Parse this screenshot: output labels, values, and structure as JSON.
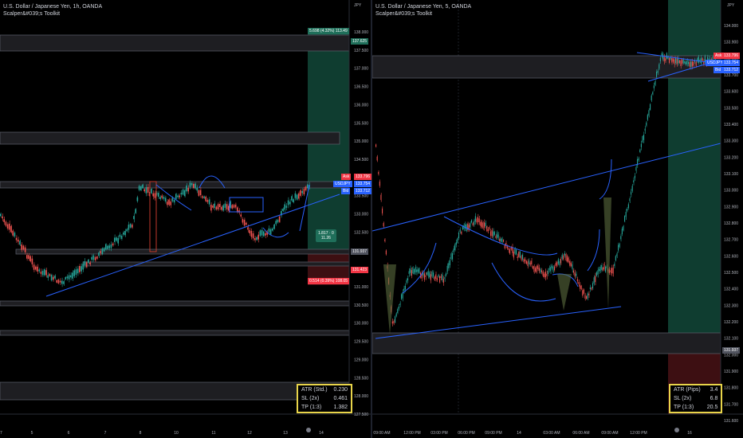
{
  "left_chart": {
    "title": "U.S. Dollar / Japanese Yen, 1h, OANDA",
    "subtitle": "Scalper&#039;s Toolkit",
    "currency": "JPY",
    "price_ticks": [
      "138.000",
      "137.500",
      "137.000",
      "136.500",
      "136.000",
      "135.500",
      "135.000",
      "134.500",
      "134.000",
      "133.500",
      "133.000",
      "132.500",
      "132.000",
      "131.500",
      "131.000",
      "130.500",
      "130.000",
      "129.500",
      "129.000",
      "128.500",
      "128.000",
      "127.500"
    ],
    "time_ticks": [
      "5",
      "6",
      "7",
      "8",
      "10",
      "11",
      "12",
      "13",
      "14",
      "17"
    ],
    "tp_label": "5.698 (4.32%) 113.49",
    "tp_price": "137.625",
    "ask_tag": "Ask",
    "ask_price": "133.796",
    "symbol_tag": "USDJPY",
    "last_price": "133.754",
    "bid_tag": "Bid",
    "bid_price": "133.712",
    "mini_label_top": "1.817 · 0",
    "mini_label_bottom": "11.26",
    "entry_price": "131.937",
    "sl_price": "131.423",
    "sl_label": "0.514 (0.39%) 108.05",
    "info": {
      "row1_label": "ATR (Std.)",
      "row1_value": "0.230",
      "row2_label": "SL (2x)",
      "row2_value": "0.461",
      "row3_label": "TP (1:3)",
      "row3_value": "1.382"
    }
  },
  "right_chart": {
    "title": "U.S. Dollar / Japanese Yen, 5, OANDA",
    "subtitle": "Scalper&#039;s Toolkit",
    "currency": "JPY",
    "price_ticks": [
      "134.000",
      "133.900",
      "133.800",
      "133.700",
      "133.600",
      "133.500",
      "133.400",
      "133.300",
      "133.200",
      "133.100",
      "133.000",
      "132.900",
      "132.800",
      "132.700",
      "132.600",
      "132.500",
      "132.400",
      "132.300",
      "132.200",
      "132.100",
      "132.000",
      "131.900",
      "131.800",
      "131.700",
      "131.600"
    ],
    "time_ticks": [
      "09:00 AM",
      "12:00 PM",
      "03:00 PM",
      "06:00 PM",
      "09:00 PM",
      "14",
      "03:00 AM",
      "06:00 AM",
      "09:00 AM",
      "12:00 PM",
      "16"
    ],
    "ask_tag": "Ask",
    "ask_price": "133.796",
    "symbol_tag": "USDJPY",
    "last_price": "133.754",
    "bid_tag": "Bid",
    "bid_price": "133.712",
    "entry_price": "131.937",
    "info": {
      "row1_label": "ATR (Pips)",
      "row1_value": "3.4",
      "row2_label": "SL (2x)",
      "row2_value": "6.8",
      "row3_label": "TP (1:3)",
      "row3_value": "20.5"
    }
  },
  "colors": {
    "bull": "#26a69a",
    "bear": "#ef5350",
    "trend": "#2962ff",
    "tp_zone": "#0f3d30",
    "sl_zone": "#3d0f12",
    "box_border": "#e8d44a",
    "ask": "#f23645",
    "bid": "#2962ff"
  }
}
